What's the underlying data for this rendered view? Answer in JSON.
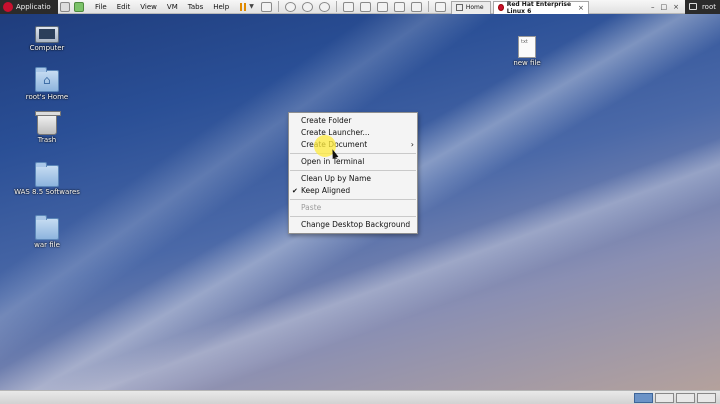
{
  "topbar": {
    "applications_label": "Applicatio",
    "menu": [
      "File",
      "Edit",
      "View",
      "VM",
      "Tabs",
      "Help"
    ],
    "tabs": [
      {
        "label": "Home",
        "icon": "home-icon"
      },
      {
        "label": "Red Hat Enterprise Linux 6",
        "icon": "redhat-icon",
        "active": true
      }
    ],
    "window_controls": [
      "–",
      "□",
      "×"
    ],
    "user_label": "root"
  },
  "desktop_icons": [
    {
      "label": "Computer",
      "icon": "computer-icon"
    },
    {
      "label": "root's Home",
      "icon": "home-folder-icon"
    },
    {
      "label": "Trash",
      "icon": "trash-icon"
    },
    {
      "label": "WAS 8.5 Softwares",
      "icon": "folder-icon"
    },
    {
      "label": "war file",
      "icon": "folder-icon"
    },
    {
      "label": "new file",
      "icon": "text-file-icon"
    }
  ],
  "context_menu": {
    "items": [
      {
        "label": "Create Folder"
      },
      {
        "label": "Create Launcher..."
      },
      {
        "label": "Create Document",
        "submenu_arrow": "›"
      },
      {
        "label": "Open in Terminal"
      },
      {
        "label": "Clean Up by Name"
      },
      {
        "label": "Keep Aligned",
        "check": "✔"
      },
      {
        "label": "Paste",
        "disabled": true
      },
      {
        "label": "Change Desktop Background"
      }
    ]
  },
  "colors": {
    "accent_highlight": "#ffeb3c",
    "redhat": "#c8102e",
    "workspace_active": "#6b93c7"
  }
}
